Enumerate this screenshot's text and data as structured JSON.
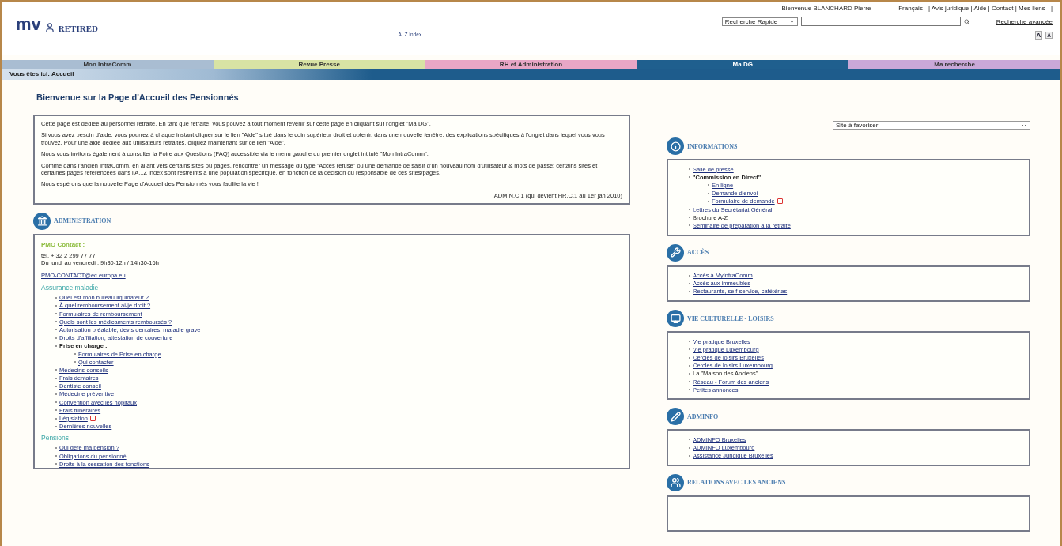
{
  "header": {
    "logo": {
      "brand": "mv",
      "sub": "RETIRED"
    },
    "az_index": "A..Z Index",
    "welcome": "Bienvenue BLANCHARD Pierre -",
    "top_links": "Français - | Avis juridique | Aide | Contact | Mes liens - |",
    "search_scope": "Recherche Rapide",
    "advanced_search": "Recherche avancée",
    "font_buttons": [
      "A",
      "A"
    ]
  },
  "tabs": [
    {
      "label": "Mon IntraComm",
      "selected": false,
      "color": "#a9bdd2"
    },
    {
      "label": "Revue Presse",
      "selected": false,
      "color": "#d8e3a4"
    },
    {
      "label": "RH et Administration",
      "selected": false,
      "color": "#e8a6c6"
    },
    {
      "label": "Ma DG",
      "selected": true,
      "color": "#1f5f8e"
    },
    {
      "label": "Ma recherche",
      "selected": false,
      "color": "#c9a8d8"
    }
  ],
  "breadcrumb": "Vous êtes ici: Accueil",
  "page_title": "Bienvenue sur la Page d'Accueil des Pensionnés",
  "intro": {
    "paragraphs": [
      "Cette page est dédiée au personnel retraité. En tant que retraité, vous pouvez à tout moment revenir sur cette page en cliquant sur l'onglet \"Ma DG\".",
      "Si vous avez besoin d'aide, vous pourrez à chaque instant cliquer sur le lien \"Aide\" situé dans le coin supérieur droit et obtenir, dans une nouvelle fenêtre, des explications spécifiques à l'onglet dans lequel vous vous trouvez. Pour une aide dédiée aux utilisateurs retraités, cliquez maintenant sur ce lien \"Aide\".",
      "Nous vous invitons également à consulter la Foire aux Questions (FAQ) accessible via le menu gauche du premier onglet intitulé \"Mon IntraComm\".",
      "Comme dans l'ancien IntraComm, en allant vers certains sites ou pages, rencontrer un message du type \"Accès refusé\" ou une demande de saisir d'un nouveau nom d'utilisateur & mots de passe: certains sites et certaines pages référencées dans l'A...Z index sont restreints à une population spécifique, en fonction de la décision du responsable de ces sites/pages.",
      "Nous espérons que la nouvelle Page d'Accueil des Pensionnés vous facilite la vie !"
    ],
    "signature": "ADMIN.C.1 (qui devient HR.C.1 au 1er jan 2010)"
  },
  "administration": {
    "title": "ADMINISTRATION",
    "kind": "admin",
    "contact": {
      "heading": "PMO Contact :",
      "phone": "tél. + 32 2 299 77 77",
      "hours": "Du lundi au vendredi : 9h30-12h / 14h30-16h",
      "email": "PMO-CONTACT@ec.europa.eu"
    },
    "subsections": [
      {
        "heading": "Assurance maladie",
        "items": [
          {
            "text": "Quel est mon bureau liquidateur ?",
            "kind": "link",
            "flag": false
          },
          {
            "text": "À quel remboursement ai-je droit ?",
            "kind": "link",
            "flag": false
          },
          {
            "text": "Formulaires de remboursement",
            "kind": "link",
            "flag": false
          },
          {
            "text": "Quels sont les médicaments remboursés ?",
            "kind": "link",
            "flag": false
          },
          {
            "text": "Autorisation préalable, devis dentaires, maladie grave",
            "kind": "link",
            "flag": false
          },
          {
            "text": "Droits d'affiliation, attestation de couverture",
            "kind": "link",
            "flag": false
          },
          {
            "text": "Prise en charge :",
            "kind": "bold",
            "flag": false,
            "children": [
              {
                "text": "Formulaires de Prise en charge",
                "kind": "link",
                "flag": false
              },
              {
                "text": "Qui contacter",
                "kind": "link",
                "flag": false
              }
            ]
          },
          {
            "text": "Médecins-conseils",
            "kind": "link",
            "flag": false
          },
          {
            "text": "Frais dentaires",
            "kind": "link",
            "flag": false
          },
          {
            "text": "Dentiste conseil",
            "kind": "link",
            "flag": false
          },
          {
            "text": "Médecine préventive",
            "kind": "link",
            "flag": false
          },
          {
            "text": "Convention avec les hôpitaux",
            "kind": "link",
            "flag": false
          },
          {
            "text": "Frais funéraires",
            "kind": "link",
            "flag": false
          },
          {
            "text": "Législation",
            "kind": "link",
            "flag": true
          },
          {
            "text": "Dernières nouvelles",
            "kind": "link",
            "flag": false
          }
        ]
      },
      {
        "heading": "Pensions",
        "items": [
          {
            "text": "Qui gère ma pension ?",
            "kind": "link",
            "flag": false
          },
          {
            "text": "Obligations du pensionné",
            "kind": "link",
            "flag": false
          },
          {
            "text": "Droits à la cessation des fonctions",
            "kind": "link",
            "flag": false
          }
        ]
      }
    ]
  },
  "site_select": "Site à favoriser",
  "right_sections": [
    {
      "title": "INFORMATIONS",
      "kind": "info",
      "items": [
        {
          "text": "Salle de presse",
          "kind": "link",
          "flag": false
        },
        {
          "text": "\"Commission en Direct\"",
          "kind": "bold",
          "flag": false,
          "children": [
            {
              "text": "En ligne",
              "kind": "link",
              "flag": false
            },
            {
              "text": "Demande d'envoi",
              "kind": "link",
              "flag": false
            },
            {
              "text": "Formulaire de demande",
              "kind": "link",
              "flag": true
            }
          ]
        },
        {
          "text": "Lettres du Secrétariat Général",
          "kind": "link",
          "flag": false
        },
        {
          "text": "Brochure A-Z",
          "kind": "plain",
          "flag": false
        },
        {
          "text": "Séminaire de préparation à la retraite",
          "kind": "link",
          "flag": false
        }
      ]
    },
    {
      "title": "ACCÈS",
      "kind": "access",
      "items": [
        {
          "text": "Accès à MyIntraComm",
          "kind": "link",
          "flag": false
        },
        {
          "text": "Accès aux immeubles",
          "kind": "link",
          "flag": false
        },
        {
          "text": "Restaurants, self-service, cafétérias",
          "kind": "link",
          "flag": false
        }
      ]
    },
    {
      "title": "VIE CULTURELLE - LOISIRS",
      "kind": "culture",
      "items": [
        {
          "text": "Vie pratique Bruxelles",
          "kind": "link",
          "flag": false
        },
        {
          "text": "Vie pratique Luxembourg",
          "kind": "link",
          "flag": false
        },
        {
          "text": "Cercles de loisirs Bruxelles",
          "kind": "link",
          "flag": false
        },
        {
          "text": "Cercles de loisirs Luxembourg",
          "kind": "link",
          "flag": false
        },
        {
          "text": "La \"Maison des Anciens\"",
          "kind": "plain",
          "flag": false
        },
        {
          "text": "Réseau - Forum des anciens",
          "kind": "link",
          "flag": false
        },
        {
          "text": "Petites annonces",
          "kind": "link",
          "flag": false
        }
      ]
    },
    {
      "title": "ADMINFO",
      "kind": "adminfo",
      "items": [
        {
          "text": "ADMINFO Bruxelles",
          "kind": "link",
          "flag": false
        },
        {
          "text": "ADMINFO Luxembourg",
          "kind": "link",
          "flag": false
        },
        {
          "text": "Assistance Juridique Bruxelles",
          "kind": "link",
          "flag": false
        }
      ]
    },
    {
      "title": "RELATIONS AVEC LES ANCIENS",
      "kind": "relations"
    }
  ]
}
